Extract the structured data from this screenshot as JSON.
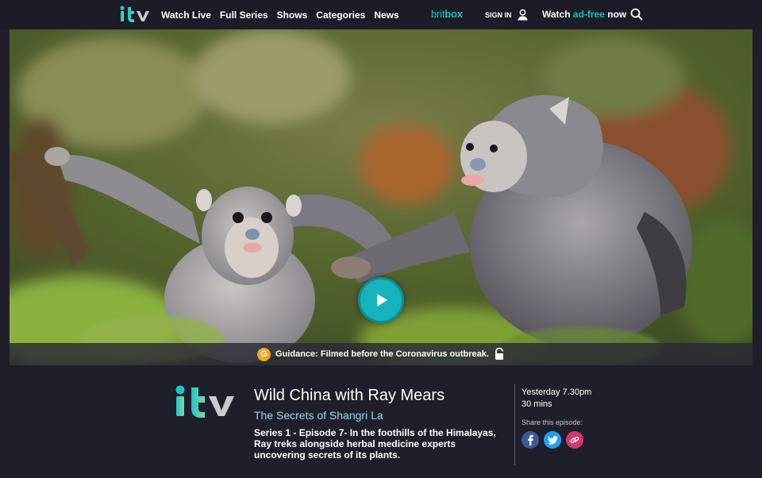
{
  "nav": {
    "links": [
      "Watch Live",
      "Full Series",
      "Shows",
      "Categories",
      "News"
    ],
    "britbox_a": "brit",
    "britbox_b": "box",
    "signin": "SIGN IN",
    "adfree_pre": "Watch ",
    "adfree_accent": "ad-free",
    "adfree_post": " now"
  },
  "hero": {
    "guidance_badge": "G",
    "guidance_text": "Guidance: Filmed before the Coronavirus outbreak."
  },
  "episode": {
    "title": "Wild China with Ray Mears",
    "subtitle": "The Secrets of Shangri La",
    "description": "Series 1 - Episode 7- In the foothills of the Himalayas, Ray treks alongside herbal medicine experts uncovering secrets of its plants.",
    "air_time": "Yesterday 7.30pm",
    "duration": "30 mins",
    "share_label": "Share this episode:"
  },
  "colors": {
    "accent": "#17c3b2",
    "play": "#17b3bd",
    "guidance": "#f2a51f",
    "background": "#1f1f2b"
  },
  "icons": [
    "itv-logo",
    "user-icon",
    "search-icon",
    "play-icon",
    "lock-icon",
    "facebook-icon",
    "twitter-icon",
    "link-icon"
  ]
}
